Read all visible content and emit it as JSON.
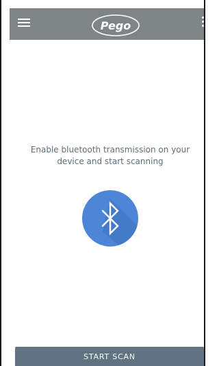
{
  "app_bar": {
    "menu_icon": "hamburger-menu-icon",
    "logo_text": "Pego",
    "overflow_icon": "more-vert-icon",
    "background_color": "#7f8487"
  },
  "main": {
    "message": "Enable bluetooth transmission on your\ndevice and start scanning",
    "bluetooth_icon": "bluetooth-icon",
    "accent_color": "#4d86d6"
  },
  "footer": {
    "start_scan_label": "START SCAN",
    "button_color": "#5f7480"
  }
}
